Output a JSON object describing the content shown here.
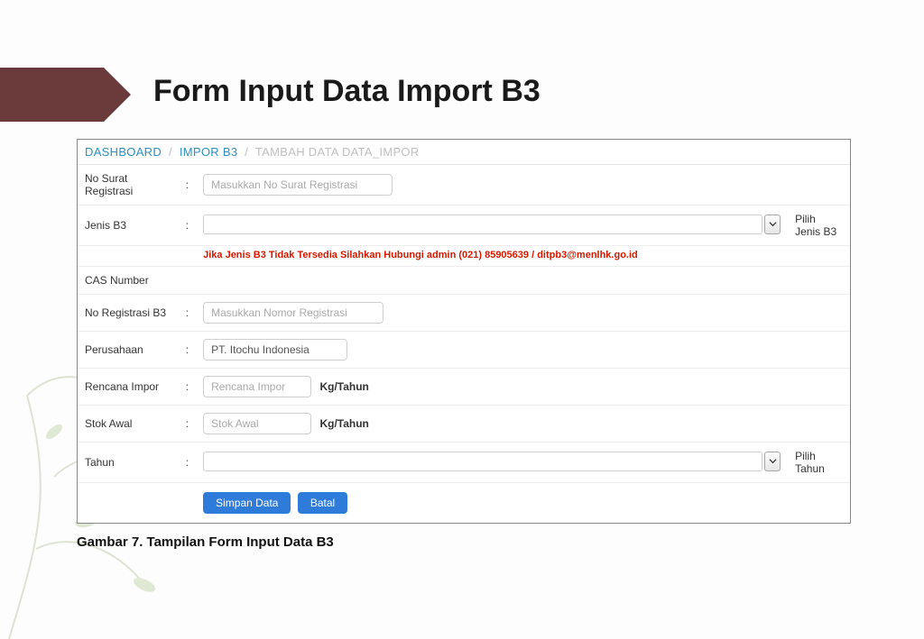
{
  "slide_title": "Form Input Data Import B3",
  "caption": "Gambar 7. Tampilan Form Input Data B3",
  "breadcrumb": {
    "items": [
      "DASHBOARD",
      "IMPOR B3",
      "TAMBAH DATA DATA_IMPOR"
    ]
  },
  "form": {
    "no_surat_registrasi": {
      "label": "No Surat Registrasi",
      "placeholder": "Masukkan No Surat Registrasi"
    },
    "jenis_b3": {
      "label": "Jenis B3",
      "hint": "Pilih Jenis B3"
    },
    "warning": "Jika Jenis B3 Tidak Tersedia Silahkan Hubungi admin (021) 85905639 / ditpb3@menlhk.go.id",
    "cas_number": {
      "label": "CAS Number"
    },
    "no_registrasi_b3": {
      "label": "No Registrasi B3",
      "placeholder": "Masukkan Nomor Registrasi"
    },
    "perusahaan": {
      "label": "Perusahaan",
      "value": "PT. Itochu Indonesia"
    },
    "rencana_impor": {
      "label": "Rencana Impor",
      "placeholder": "Rencana Impor",
      "unit": "Kg/Tahun"
    },
    "stok_awal": {
      "label": "Stok Awal",
      "placeholder": "Stok Awal",
      "unit": "Kg/Tahun"
    },
    "tahun": {
      "label": "Tahun",
      "hint": "Pilih Tahun"
    },
    "buttons": {
      "save": "Simpan Data",
      "cancel": "Batal"
    }
  }
}
